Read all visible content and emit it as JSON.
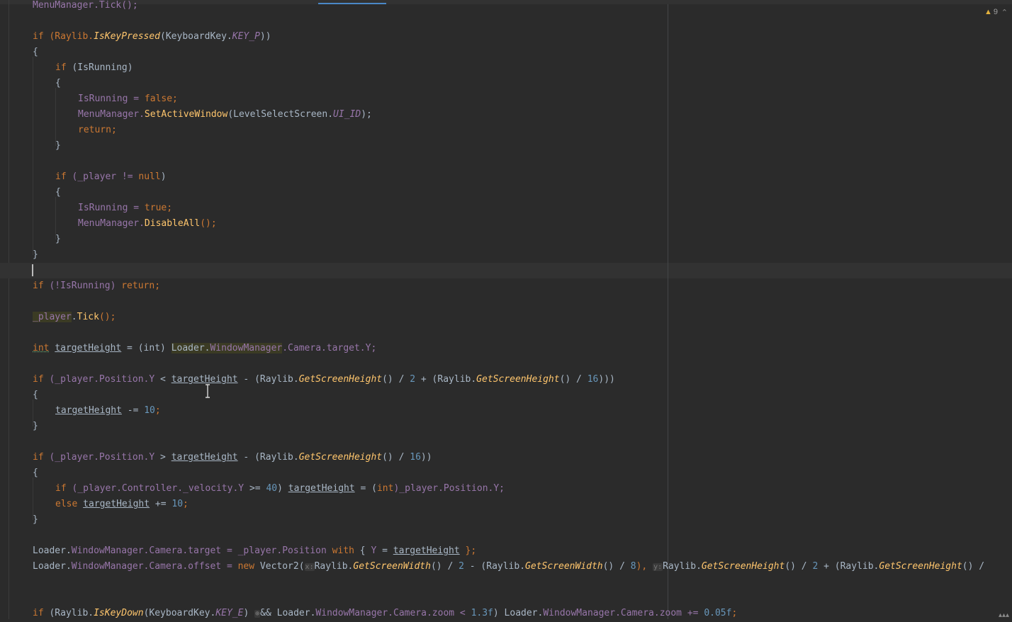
{
  "editor": {
    "warnings_count": "9",
    "lines": {
      "l0": "MenuManager.Tick();",
      "l1_a": "if (Raylib.",
      "l1_b": "IsKeyPressed",
      "l1_c": "(KeyboardKey.",
      "l1_d": "KEY_P",
      "l1_e": "))",
      "l2": "{",
      "l3_a": "if",
      "l3_b": " (IsRunning)",
      "l4": "{",
      "l5_a": "IsRunning = ",
      "l5_b": "false;",
      "l6_a": "MenuManager.",
      "l6_b": "SetActiveWindow",
      "l6_c": "(LevelSelectScreen.",
      "l6_d": "UI_ID",
      "l6_e": ");",
      "l7": "return;",
      "l8": "}",
      "l10_a": "if",
      "l10_b": " (_player != ",
      "l10_c": "null",
      "l10_d": ")",
      "l11": "{",
      "l12_a": "IsRunning = ",
      "l12_b": "true;",
      "l13_a": "MenuManager.",
      "l13_b": "DisableAll",
      "l13_c": "();",
      "l14": "}",
      "l15": "}",
      "l17_a": "if",
      "l17_b": " (!IsRunning) ",
      "l17_c": "return;",
      "l19_a": "_player",
      "l19_b": ".",
      "l19_c": "Tick",
      "l19_d": "();",
      "l21_a": "int",
      "l21_b": " ",
      "l21_c": "targetHeight",
      "l21_d": " = (int) ",
      "l21_e": "Loader.",
      "l21_f": "WindowManager",
      "l21_g": ".Camera.target.",
      "l21_h": "Y;",
      "l23_a": "if",
      "l23_b": " (_player.Position.",
      "l23_c": "Y",
      "l23_d": " < ",
      "l23_e": "targetHeight",
      "l23_f": " - (Raylib.",
      "l23_g": "GetScreenHeight",
      "l23_h": "() / ",
      "l23_i": "2",
      "l23_j": " + (Raylib.",
      "l23_k": "GetScreenHeight",
      "l23_l": "() / ",
      "l23_m": "16",
      "l23_n": ")))",
      "l24": "{",
      "l25_a": "targetHeight",
      "l25_b": " -= ",
      "l25_c": "10",
      "l25_d": ";",
      "l26": "}",
      "l28_a": "if",
      "l28_b": " (_player.Position.",
      "l28_c": "Y",
      "l28_d": " > ",
      "l28_e": "targetHeight",
      "l28_f": " - (Raylib.",
      "l28_g": "GetScreenHeight",
      "l28_h": "() / ",
      "l28_i": "16",
      "l28_j": "))",
      "l29": "{",
      "l30_a": "if",
      "l30_b": " (_player.Controller._velocity.",
      "l30_c": "Y",
      "l30_d": " >= ",
      "l30_e": "40",
      "l30_f": ") ",
      "l30_g": "targetHeight",
      "l30_h": " = (",
      "l30_i": "int",
      "l30_j": ")_player.Position.",
      "l30_k": "Y;",
      "l31_a": "else",
      "l31_b": " ",
      "l31_c": "targetHeight",
      "l31_d": " += ",
      "l31_e": "10",
      "l31_f": ";",
      "l32": "}",
      "l34_a": "Loader.",
      "l34_b": "WindowManager",
      "l34_c": ".Camera.target = _player.Position ",
      "l34_d": "with",
      "l34_e": " { ",
      "l34_f": "Y",
      "l34_g": " = ",
      "l34_h": "targetHeight",
      "l34_i": " };",
      "l35_a": "Loader.",
      "l35_b": "WindowManager",
      "l35_c": ".Camera.offset = ",
      "l35_d": "new",
      "l35_e": " Vector2(",
      "l35_hint_x": "x:",
      "l35_f": "Raylib.",
      "l35_g": "GetScreenWidth",
      "l35_h": "() / ",
      "l35_i": "2",
      "l35_j": " - (Raylib.",
      "l35_k": "GetScreenWidth",
      "l35_l": "() / ",
      "l35_m": "8",
      "l35_n": "), ",
      "l35_hint_y": "y:",
      "l35_o": "Raylib.",
      "l35_p": "GetScreenHeight",
      "l35_q": "() / ",
      "l35_r": "2",
      "l35_s": " + (Raylib.",
      "l35_t": "GetScreenHeight",
      "l35_u": "() /",
      "l38_a": "if",
      "l38_b": " (Raylib.",
      "l38_c": "IsKeyDown",
      "l38_d": "(KeyboardKey.",
      "l38_e": "KEY_E",
      "l38_f": ") ",
      "l38_hint": "⊛",
      "l38_g": "&& Loader.",
      "l38_h": "WindowManager",
      "l38_i": ".Camera.zoom < ",
      "l38_j": "1.3f",
      "l38_k": ") Loader.",
      "l38_l": "WindowManager",
      "l38_m": ".Camera.zoom += ",
      "l38_n": "0.05f",
      "l38_o": ";"
    }
  },
  "colors": {
    "background": "#2b2b2b",
    "keyword": "#cc7832",
    "method": "#ffc66d",
    "field": "#9876aa",
    "number": "#6897bb",
    "text": "#a9b7c6"
  },
  "icons": {
    "warning": "warning-triangle-icon",
    "expand": "chevron-up-icon"
  }
}
